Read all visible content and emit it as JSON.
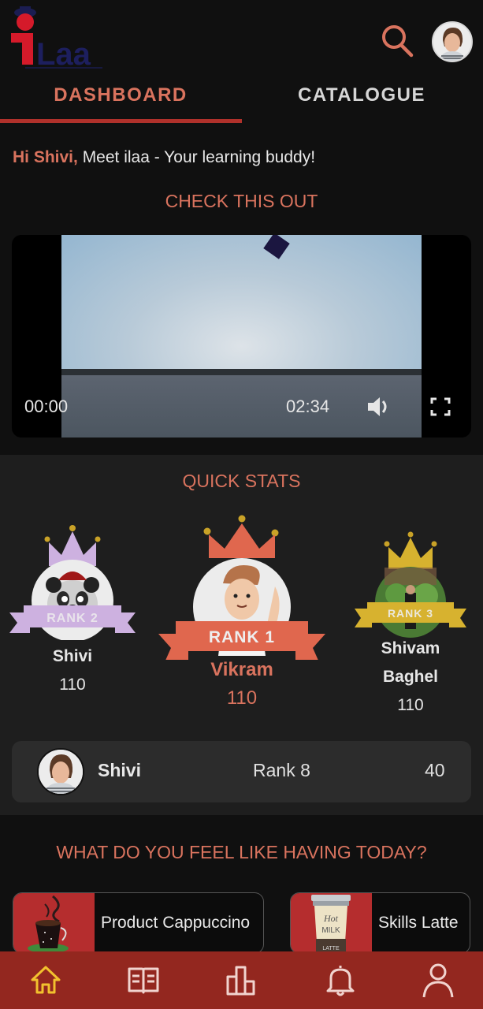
{
  "app": {
    "logo_text": "iLaa",
    "brand_color": "#d9735e",
    "accent_dark_red": "#93271f"
  },
  "header": {
    "search_icon": "search-icon",
    "avatar_icon": "user-avatar"
  },
  "tabs": [
    {
      "label": "DASHBOARD",
      "active": true
    },
    {
      "label": "CATALOGUE",
      "active": false
    }
  ],
  "greeting": {
    "hi": "Hi Shivi,",
    "message": " Meet ilaa - Your learning buddy!"
  },
  "check_this_out": {
    "title": "CHECK THIS OUT",
    "video": {
      "current_time": "00:00",
      "duration": "02:34",
      "volume_icon": "volume-icon",
      "fullscreen_icon": "fullscreen-icon"
    }
  },
  "quick_stats": {
    "title": "QUICK STATS",
    "leaders": [
      {
        "rank_label": "RANK 2",
        "name": "Shivi",
        "score": "110",
        "color": "#cdb1e0"
      },
      {
        "rank_label": "RANK 1",
        "name": "Vikram",
        "score": "110",
        "color": "#e0674e"
      },
      {
        "rank_label": "RANK 3",
        "name_line1": "Shivam",
        "name_line2": "Baghel",
        "score": "110",
        "color": "#d7b22f"
      }
    ],
    "my_rank": {
      "name": "Shivi",
      "rank": "Rank 8",
      "points": "40"
    }
  },
  "menu": {
    "title": "WHAT DO YOU FEEL LIKE HAVING TODAY?",
    "cards": [
      {
        "label": "Product Cappuccino",
        "icon": "coffee-cup-icon"
      },
      {
        "label": "Skills Latte",
        "icon": "hot-milk-latte-icon"
      }
    ]
  },
  "bottom_nav": [
    {
      "name": "home",
      "active": true,
      "color": "#f2c12e"
    },
    {
      "name": "catalogue-book",
      "active": false
    },
    {
      "name": "leaderboard",
      "active": false
    },
    {
      "name": "notifications",
      "active": false
    },
    {
      "name": "profile",
      "active": false
    }
  ]
}
